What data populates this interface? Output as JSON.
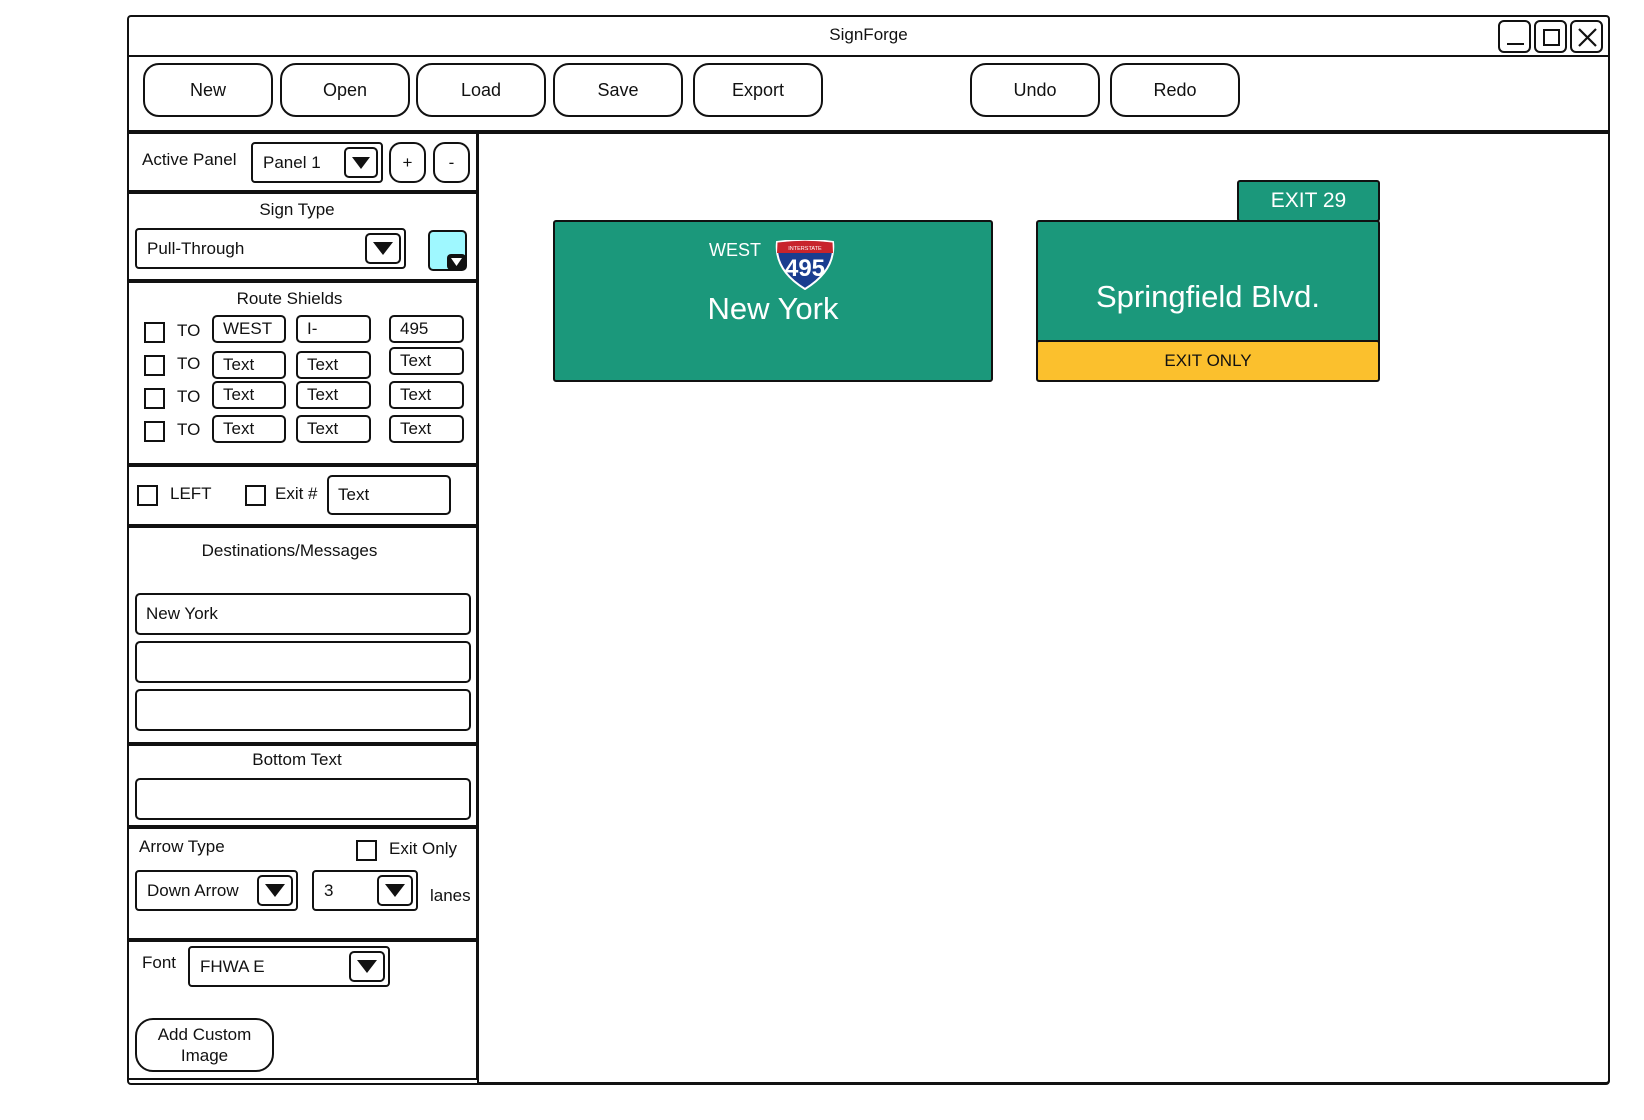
{
  "window": {
    "title": "SignForge"
  },
  "toolbar": {
    "new": "New",
    "open": "Open",
    "load": "Load",
    "save": "Save",
    "export": "Export",
    "undo": "Undo",
    "redo": "Redo"
  },
  "panel": {
    "active_label": "Active Panel",
    "active_value": "Panel 1",
    "add": "+",
    "remove": "-"
  },
  "sign_type": {
    "heading": "Sign Type",
    "value": "Pull-Through",
    "color_swatch": "#9ff8ff"
  },
  "route_shields": {
    "heading": "Route Shields",
    "rows": [
      {
        "to": "TO",
        "direction": "WEST",
        "type": "I-",
        "number": "495"
      },
      {
        "to": "TO",
        "direction": "Text",
        "type": "Text",
        "number": "Text"
      },
      {
        "to": "TO",
        "direction": "Text",
        "type": "Text",
        "number": "Text"
      },
      {
        "to": "TO",
        "direction": "Text",
        "type": "Text",
        "number": "Text"
      }
    ]
  },
  "exit_options": {
    "left_label": "LEFT",
    "exit_num_label": "Exit #",
    "exit_num_value": "Text"
  },
  "destinations": {
    "heading": "Destinations/Messages",
    "lines": [
      "New York",
      "",
      ""
    ]
  },
  "bottom_text": {
    "heading": "Bottom Text",
    "value": ""
  },
  "arrow": {
    "heading": "Arrow Type",
    "exit_only_label": "Exit Only",
    "type_value": "Down Arrow",
    "lanes_value": "3",
    "lanes_label": "lanes"
  },
  "font": {
    "label": "Font",
    "value": "FHWA E",
    "custom_image_button": "Add Custom Image"
  },
  "canvas": {
    "sign1": {
      "direction": "WEST",
      "shield_banner": "INTERSTATE",
      "shield_number": "495",
      "destination": "New York"
    },
    "sign2": {
      "exit_tab": "EXIT 29",
      "destination": "Springfield Blvd.",
      "exit_only": "EXIT ONLY"
    },
    "colors": {
      "sign_green": "#1b987b",
      "exit_only_yellow": "#fbc02d",
      "shield_blue": "#1a3d8f",
      "shield_red": "#c8242c"
    }
  }
}
